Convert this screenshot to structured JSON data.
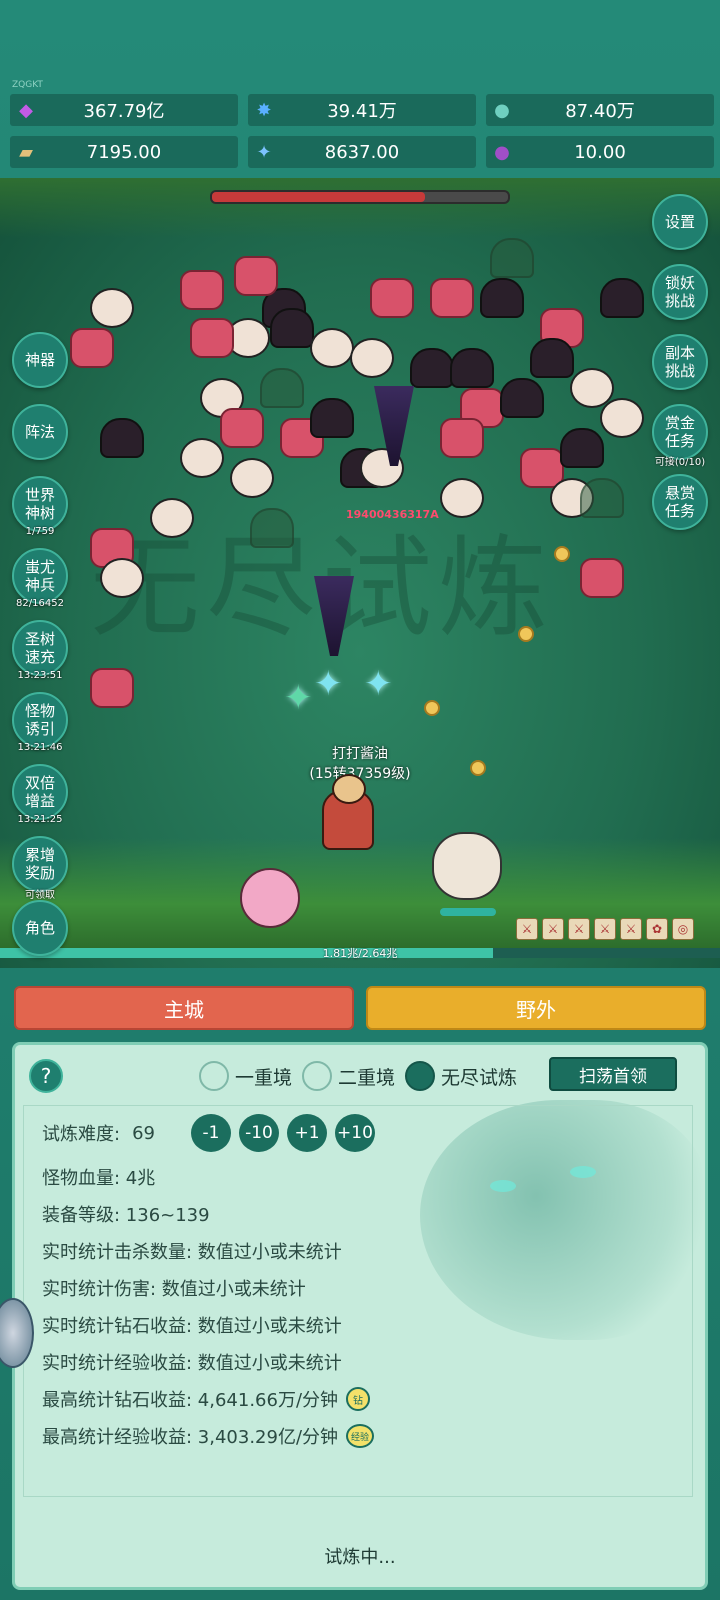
{
  "brand": "ZQGKT",
  "resources": [
    {
      "icon": "purple-gem-icon",
      "value": "367.79亿",
      "color": "#b04bd8"
    },
    {
      "icon": "blue-crystal-icon",
      "value": "39.41万",
      "color": "#4da6f5"
    },
    {
      "icon": "teal-orb-icon",
      "value": "87.40万",
      "color": "#4fb6a8"
    },
    {
      "icon": "scroll-icon",
      "value": "7195.00",
      "color": "#d8b06a"
    },
    {
      "icon": "blue-shard-icon",
      "value": "8637.00",
      "color": "#64b4ff"
    },
    {
      "icon": "purple-pouch-icon",
      "value": "10.00",
      "color": "#8b3fb0"
    }
  ],
  "boss_hp_fraction": 0.72,
  "left_menu": [
    {
      "label": "神器",
      "sub": ""
    },
    {
      "label": "阵法",
      "sub": ""
    },
    {
      "label": "世界神树",
      "sub": "1/759"
    },
    {
      "label": "蚩尤神兵",
      "sub": "82/16452"
    },
    {
      "label": "圣树速充",
      "sub": "13:23:51"
    },
    {
      "label": "怪物诱引",
      "sub": "13:21:46"
    },
    {
      "label": "双倍增益",
      "sub": "13:21:25"
    },
    {
      "label": "累增奖励",
      "sub": "可领取"
    },
    {
      "label": "角色",
      "sub": ""
    }
  ],
  "right_menu": [
    {
      "label": "设置",
      "sub": ""
    },
    {
      "label": "锁妖挑战",
      "sub": ""
    },
    {
      "label": "副本挑战",
      "sub": ""
    },
    {
      "label": "赏金任务",
      "sub": "可接(0/10)"
    },
    {
      "label": "悬赏任务",
      "sub": ""
    }
  ],
  "battle": {
    "damage_text": "19400436317A",
    "player_name": "打打酱油",
    "player_level": "(15转37359级)",
    "xp_text": "1.81兆/2.64兆",
    "xp_fraction": 0.685,
    "watermark": "无尽试炼"
  },
  "tabs": {
    "main_city": "主城",
    "wild": "野外"
  },
  "panel": {
    "help": "?",
    "modes": [
      {
        "label": "一重境",
        "selected": false
      },
      {
        "label": "二重境",
        "selected": false
      },
      {
        "label": "无尽试炼",
        "selected": true
      }
    ],
    "sweep_button": "扫荡首领",
    "difficulty_label": "试炼难度:",
    "difficulty_value": "69",
    "adjust_buttons": [
      "-1",
      "-10",
      "+1",
      "+10"
    ],
    "stats": [
      "怪物血量: 4兆",
      "装备等级: 136~139",
      "实时统计击杀数量: 数值过小或未统计",
      "实时统计伤害: 数值过小或未统计",
      "实时统计钻石收益: 数值过小或未统计",
      "实时统计经验收益: 数值过小或未统计"
    ],
    "best_diamond": "最高统计钻石收益: 4,641.66万/分钟",
    "best_diamond_badge": "钻",
    "best_exp": "最高统计经验收益: 3,403.29亿/分钟",
    "best_exp_badge": "经验",
    "status": "试炼中..."
  }
}
